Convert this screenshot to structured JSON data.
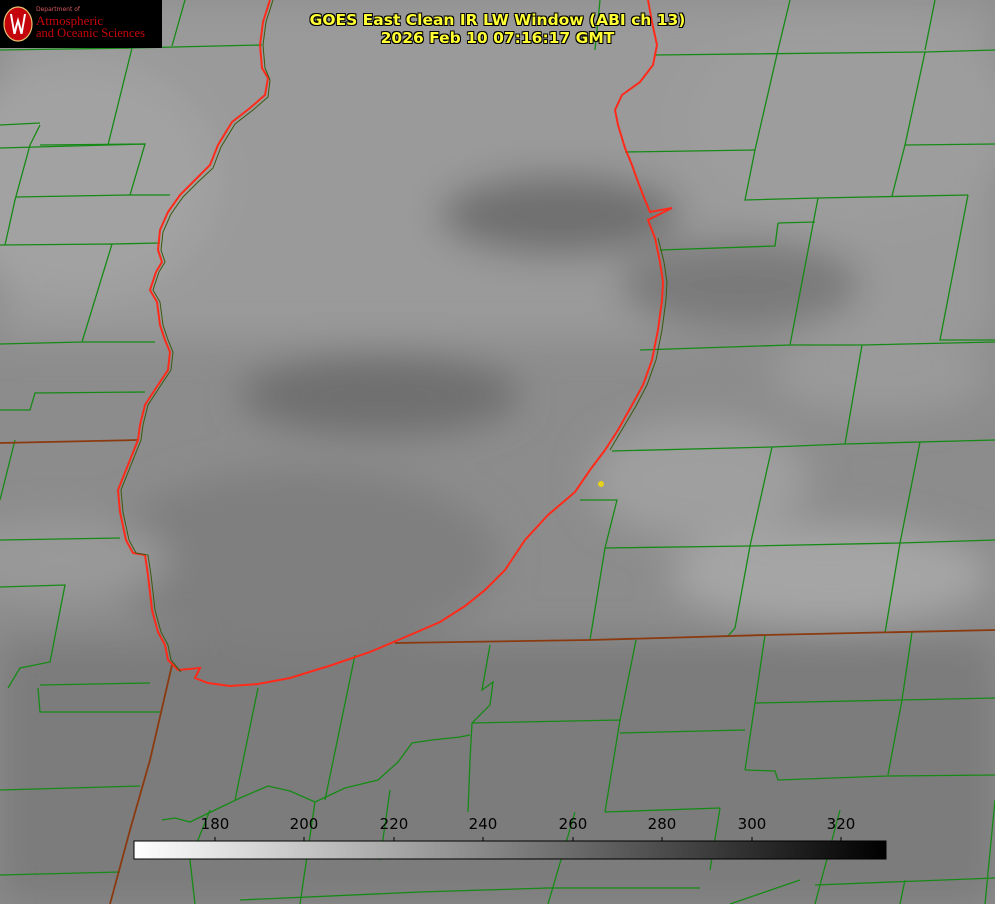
{
  "title": {
    "line1": "GOES East Clean IR LW Window (ABI ch 13)",
    "line2": "2026 Feb 10 07:16:17 GMT"
  },
  "logo": {
    "department": "Department of",
    "line1": "Atmospheric",
    "line2": "and Oceanic Sciences",
    "icon": "uw-crest-icon"
  },
  "colorbar": {
    "ticks": [
      "180",
      "200",
      "220",
      "240",
      "260",
      "280",
      "300",
      "320"
    ],
    "range": [
      162,
      330
    ],
    "gradient": [
      "#ffffff",
      "#000000"
    ]
  },
  "colors": {
    "lake_outline": "#ff2a1a",
    "county_lines": "#168a16",
    "state_lines": "#8b3a10",
    "marker": "#e6d21a"
  }
}
